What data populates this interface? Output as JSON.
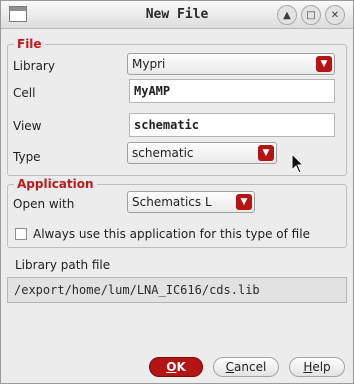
{
  "window": {
    "title": "New File"
  },
  "file_group": {
    "legend": "File",
    "library_label": "Library",
    "library_value": "Mypri",
    "cell_label": "Cell",
    "cell_value": "MyAMP",
    "view_label": "View",
    "view_value": "schematic",
    "type_label": "Type",
    "type_value": "schematic"
  },
  "application_group": {
    "legend": "Application",
    "open_with_label": "Open with",
    "open_with_value": "Schematics L",
    "always_use_label": "Always use this application for this type of file",
    "always_use_checked": false
  },
  "library_path": {
    "label": "Library path file",
    "value": "/export/home/lum/LNA_IC616/cds.lib"
  },
  "buttons": {
    "ok": {
      "first": "O",
      "rest": "K"
    },
    "cancel": {
      "first": "C",
      "rest": "ancel"
    },
    "help": {
      "first": "H",
      "rest": "elp"
    }
  },
  "colors": {
    "accent_red": "#b51414",
    "legend_red": "#c01a1a"
  }
}
